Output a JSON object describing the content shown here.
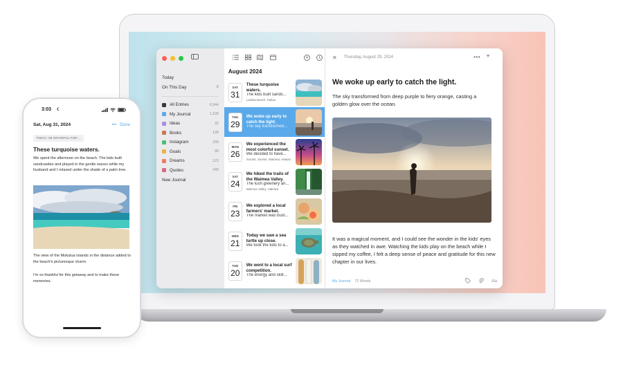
{
  "colors": {
    "accent": "#5aa9ea",
    "traffic_red": "#ff5f57",
    "traffic_yellow": "#febc2e",
    "traffic_green": "#28c840"
  },
  "sidebar": {
    "nav": [
      {
        "label": "Today",
        "count": ""
      },
      {
        "label": "On This Day",
        "count": "8"
      }
    ],
    "journals": [
      {
        "name": "All Entries",
        "count": "6,544",
        "color": "#3a3a3c"
      },
      {
        "name": "My Journal",
        "count": "1,109",
        "color": "#5aa9ea"
      },
      {
        "name": "Ideas",
        "count": "32",
        "color": "#a98ee0"
      },
      {
        "name": "Books",
        "count": "128",
        "color": "#c87b4c"
      },
      {
        "name": "Instagram",
        "count": "299",
        "color": "#4fbd7a"
      },
      {
        "name": "Goals",
        "count": "90",
        "color": "#e7b54a"
      },
      {
        "name": "Dreams",
        "count": "123",
        "color": "#ef7b62"
      },
      {
        "name": "Quotes",
        "count": "245",
        "color": "#d86a87"
      }
    ],
    "new_journal": "New Journal"
  },
  "list": {
    "month": "August 2024",
    "entries": [
      {
        "dow": "SAT",
        "day": "31",
        "title": "These turquoise waters.",
        "snippet": "The kids built sandc...",
        "location": "Lanikai Beach, Kailua",
        "thumb": "beach"
      },
      {
        "dow": "THU",
        "day": "29",
        "title": "We woke up early to catch the light.",
        "snippet": "The sky transformed...",
        "location": "",
        "thumb": "sunset",
        "selected": true
      },
      {
        "dow": "MON",
        "day": "26",
        "title": "We experienced the most colorful sunset.",
        "snippet": "We decided to have...",
        "location": "Sunset, Sunset, Waimea, Hawaii",
        "thumb": "palms"
      },
      {
        "dow": "SAT",
        "day": "24",
        "title": "We hiked the  trails of the Waimea Valley.",
        "snippet": "The lush greenery an...",
        "location": "Waimea Valley, Haleiwa",
        "thumb": "waterfall"
      },
      {
        "dow": "FRI",
        "day": "23",
        "title": "We explored a local farmers' market.",
        "snippet": "The market was bust...",
        "location": "",
        "thumb": "market"
      },
      {
        "dow": "WED",
        "day": "21",
        "title": "Today we saw a sea turtle up close.",
        "snippet": "We took the kids to a...",
        "location": "",
        "thumb": "turtle"
      },
      {
        "dow": "TUE",
        "day": "20",
        "title": "We went to a local surf competition.",
        "snippet": "The energy and skill...",
        "location": "",
        "thumb": "surf"
      }
    ]
  },
  "editor": {
    "date": "Thursday, August 29, 2024",
    "title": "We woke up early to catch the light.",
    "lede": "The sky transformed from deep purple to fiery orange, casting a golden glow over the ocean.",
    "body": "It was a magical moment, and I could see the wonder in the kids' eyes as they watched in awe. Watching the kids play on the beach while I sipped my coffee, I felt a deep sense of peace and gratitude for this new chapter in our lives.",
    "footer_journal": "My Journal",
    "footer_words": "72 Words",
    "format_label": "Aa"
  },
  "phone": {
    "time": "3:03",
    "date": "Sat, Aug 31, 2024",
    "more": "•••",
    "done": "Done",
    "prompt": "TODAY, I'M GRATEFUL FOR ...",
    "title": "These turquoise waters.",
    "p1": "We spent the afternoon on the beach. The kids built sandcastles and played in the gentle waves while my husband and I relaxed under the shade of a palm tree.",
    "p2": "The view of the Mokulua Islands in the distance added to the beach's picturesque charm.",
    "p3": "I'm so thankful for this getaway and to make these memories."
  }
}
